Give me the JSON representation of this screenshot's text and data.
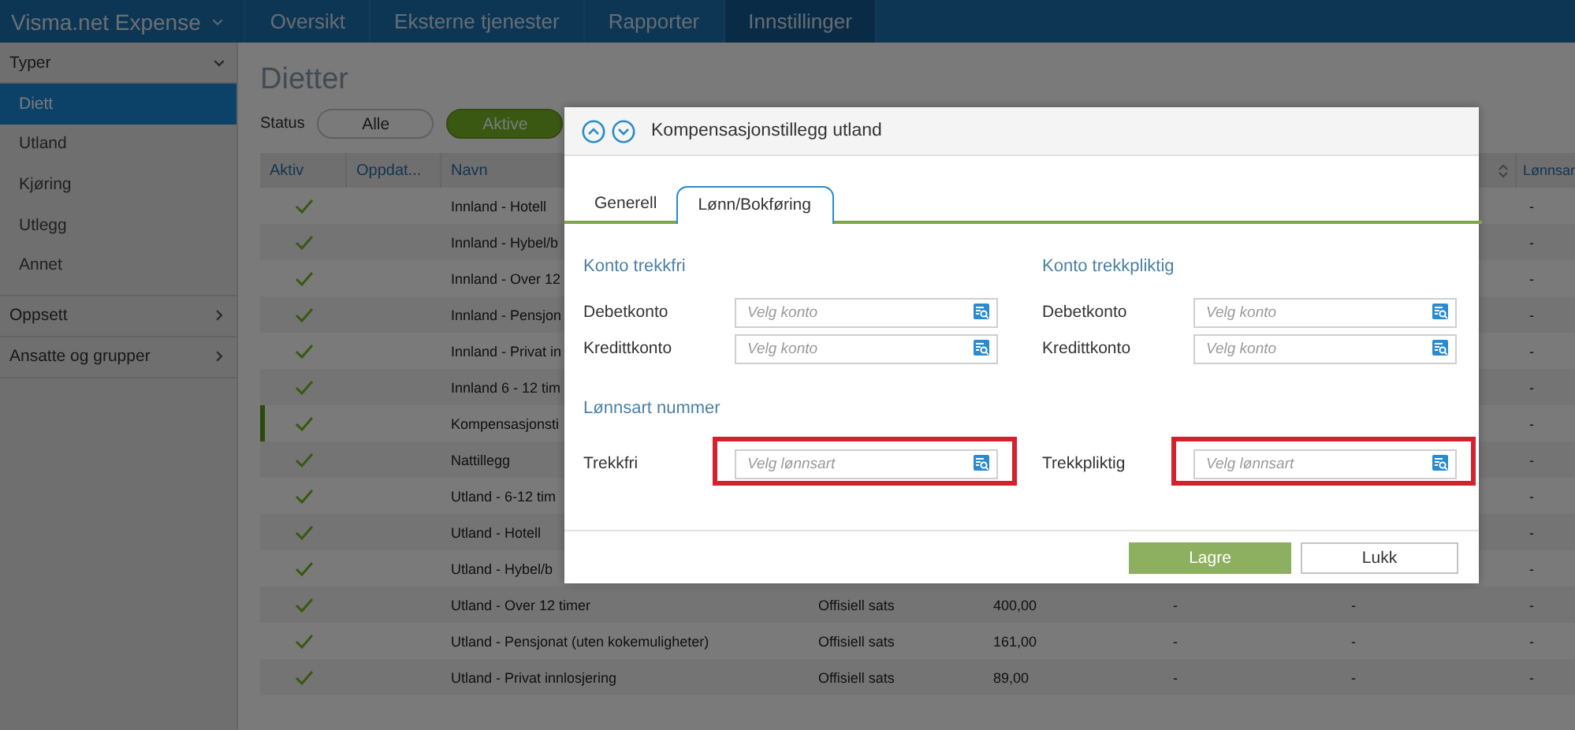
{
  "nav": {
    "brand": "Visma.net Expense",
    "items": [
      {
        "label": "Oversikt",
        "selected": false
      },
      {
        "label": "Eksterne tjenester",
        "selected": false
      },
      {
        "label": "Rapporter",
        "selected": false
      },
      {
        "label": "Innstillinger",
        "selected": true
      }
    ]
  },
  "sidebar": {
    "groups": [
      {
        "label": "Typer",
        "expanded": true,
        "children": [
          {
            "label": "Diett",
            "selected": true
          },
          {
            "label": "Utland",
            "selected": false
          },
          {
            "label": "Kjøring",
            "selected": false
          },
          {
            "label": "Utlegg",
            "selected": false
          },
          {
            "label": "Annet",
            "selected": false
          }
        ]
      },
      {
        "label": "Oppsett",
        "expanded": false
      },
      {
        "label": "Ansatte og grupper",
        "expanded": false
      }
    ]
  },
  "page": {
    "title": "Dietter",
    "status": {
      "label": "Status",
      "options": [
        {
          "label": "Alle",
          "selected": false
        },
        {
          "label": "Aktive",
          "selected": true
        }
      ]
    }
  },
  "table": {
    "columns": [
      "Aktiv",
      "Oppdat...",
      "Navn",
      "Lønnsar"
    ],
    "rows": [
      {
        "active": true,
        "selected": false,
        "name": "Innland - Hotell",
        "lonnsart": "-"
      },
      {
        "active": true,
        "selected": false,
        "name": "Innland - Hybel/b",
        "lonnsart": "-"
      },
      {
        "active": true,
        "selected": false,
        "name": "Innland - Over 12",
        "lonnsart": "-"
      },
      {
        "active": true,
        "selected": false,
        "name": "Innland - Pensjon",
        "lonnsart": "-"
      },
      {
        "active": true,
        "selected": false,
        "name": "Innland - Privat in",
        "lonnsart": "-"
      },
      {
        "active": true,
        "selected": false,
        "name": "Innland 6 - 12 tim",
        "lonnsart": "-"
      },
      {
        "active": true,
        "selected": true,
        "name": "Kompensasjonsti",
        "lonnsart": "-"
      },
      {
        "active": true,
        "selected": false,
        "name": "Nattillegg",
        "lonnsart": "-"
      },
      {
        "active": true,
        "selected": false,
        "name": "Utland - 6-12 tim",
        "lonnsart": "-"
      },
      {
        "active": true,
        "selected": false,
        "name": "Utland - Hotell",
        "lonnsart": "-"
      },
      {
        "active": true,
        "selected": false,
        "name": "Utland - Hybel/b",
        "lonnsart": "-"
      },
      {
        "active": true,
        "selected": false,
        "name": "Utland - Over 12 timer",
        "column_4": "Offisiell sats",
        "column_5": "400,00",
        "column_6": "-",
        "column_7": "-",
        "lonnsart": "-"
      },
      {
        "active": true,
        "selected": false,
        "name": "Utland - Pensjonat (uten kokemuligheter)",
        "column_4": "Offisiell sats",
        "column_5": "161,00",
        "column_6": "-",
        "column_7": "-",
        "lonnsart": "-"
      },
      {
        "active": true,
        "selected": false,
        "name": "Utland - Privat innlosjering",
        "column_4": "Offisiell sats",
        "column_5": "89,00",
        "column_6": "-",
        "column_7": "-",
        "lonnsart": "-"
      }
    ]
  },
  "dialog": {
    "title": "Kompensasjonstillegg utland",
    "tabs": [
      {
        "label": "Generell",
        "selected": false
      },
      {
        "label": "Lønn/Bokføring",
        "selected": true
      }
    ],
    "sections": [
      {
        "columns": [
          {
            "heading": "Konto trekkfri",
            "fields": [
              {
                "label": "Debetkonto",
                "placeholder": "Velg konto",
                "highlighted": false
              },
              {
                "label": "Kredittkonto",
                "placeholder": "Velg konto",
                "highlighted": false
              }
            ]
          },
          {
            "heading": "Konto trekkpliktig",
            "fields": [
              {
                "label": "Debetkonto",
                "placeholder": "Velg konto",
                "highlighted": false
              },
              {
                "label": "Kredittkonto",
                "placeholder": "Velg konto",
                "highlighted": false
              }
            ]
          }
        ]
      },
      {
        "heading": "Lønnsart nummer",
        "columns": [
          {
            "fields": [
              {
                "label": "Trekkfri",
                "placeholder": "Velg lønnsart",
                "highlighted": true
              }
            ]
          },
          {
            "fields": [
              {
                "label": "Trekkpliktig",
                "placeholder": "Velg lønnsart",
                "highlighted": true
              }
            ]
          }
        ]
      }
    ],
    "buttons": [
      {
        "label": "Lagre",
        "kind": "primary"
      },
      {
        "label": "Lukk",
        "kind": "secondary"
      }
    ]
  }
}
